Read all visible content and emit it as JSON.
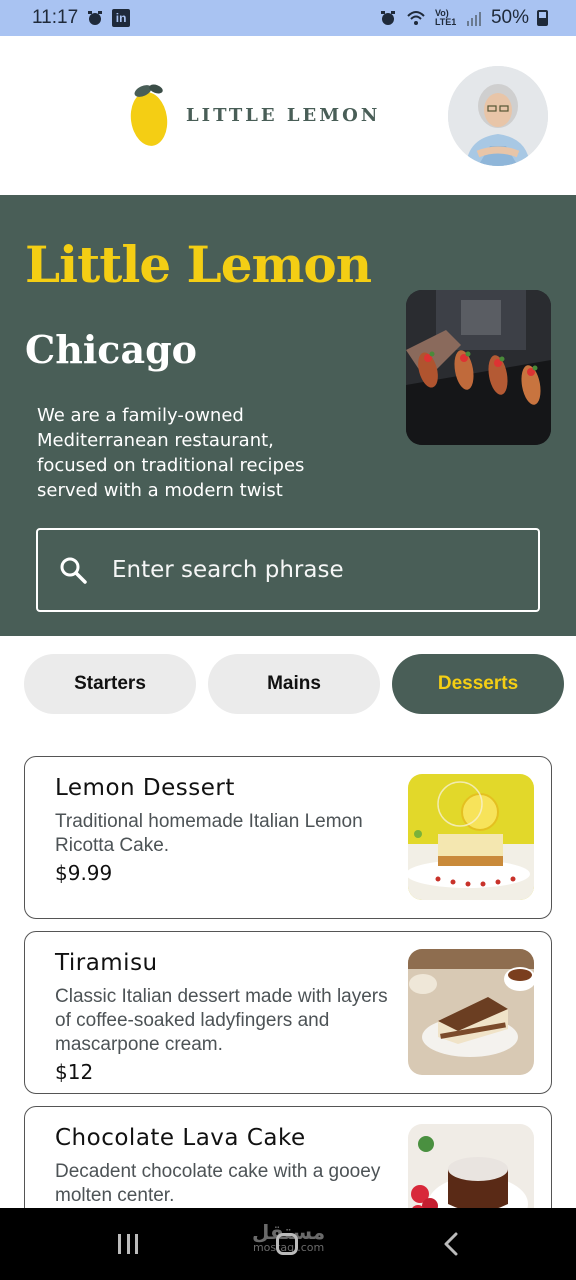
{
  "status_bar": {
    "time": "11:17",
    "battery": "50%",
    "network": "Vo) LTE1"
  },
  "header": {
    "logo_text": "LITTLE LEMON"
  },
  "hero": {
    "title": "Little Lemon",
    "city": "Chicago",
    "description": "We are a family-owned Mediterranean restaurant, focused on traditional recipes served with a modern twist",
    "search_placeholder": "Enter search phrase"
  },
  "categories": [
    {
      "label": "Starters",
      "active": false
    },
    {
      "label": "Mains",
      "active": false
    },
    {
      "label": "Desserts",
      "active": true
    }
  ],
  "menu": [
    {
      "title": "Lemon Dessert",
      "description": "Traditional homemade Italian Lemon Ricotta Cake.",
      "price": "$9.99"
    },
    {
      "title": "Tiramisu",
      "description": "Classic Italian dessert made with layers of coffee-soaked ladyfingers and mascarpone cream.",
      "price": "$12"
    },
    {
      "title": "Chocolate Lava Cake",
      "description": "Decadent chocolate cake with a gooey molten center.",
      "price": ""
    }
  ],
  "watermark": {
    "arabic": "مستقل",
    "latin": "mostaql.com"
  },
  "colors": {
    "brand_green": "#495e57",
    "brand_yellow": "#f4ce14",
    "status_bar": "#a9c3f2"
  }
}
